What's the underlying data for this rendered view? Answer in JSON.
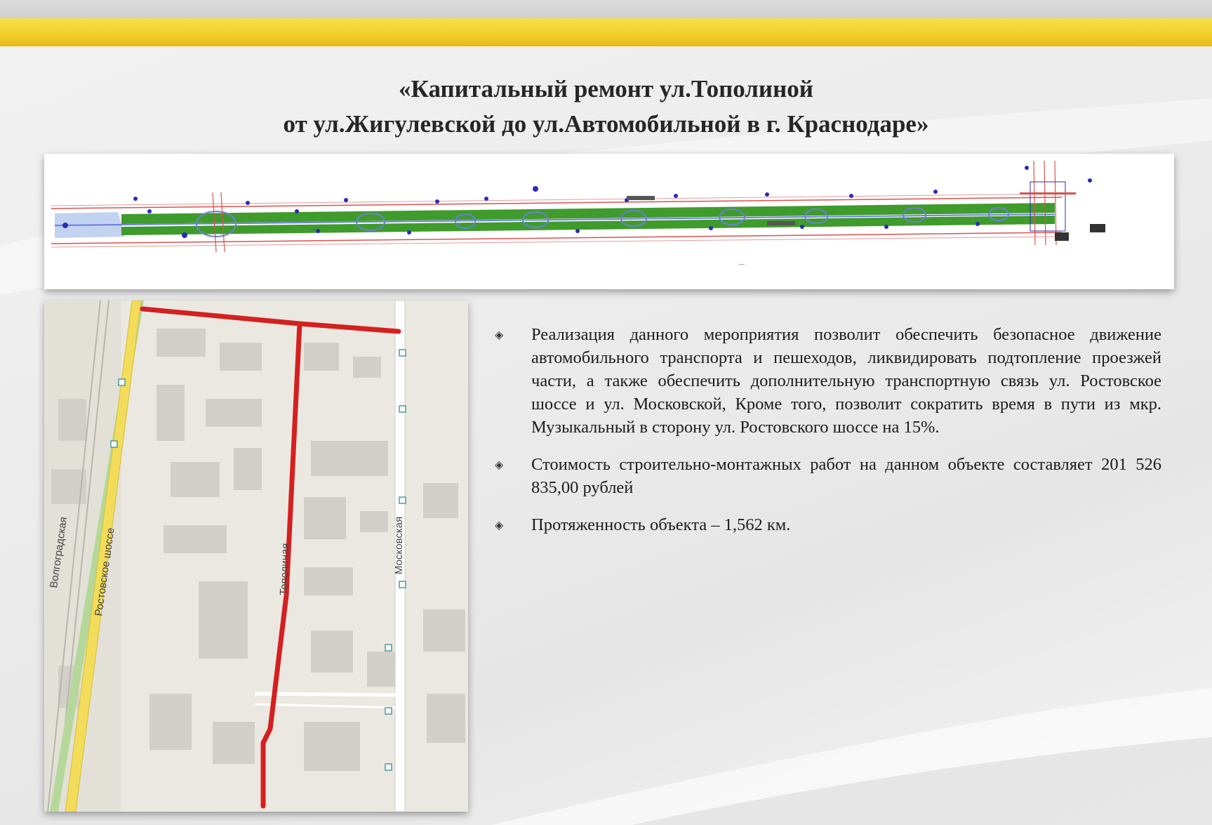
{
  "title": {
    "line1": "«Капитальный ремонт ул.Тополиной",
    "line2": "от ул.Жигулевской до ул.Автомобильной в г. Краснодаре»"
  },
  "map": {
    "labels": {
      "volgogradskaya": "Волгоградская",
      "rostovskoe": "Ростовское шоссе",
      "topolinaya": "Тополиная",
      "moskovskaya": "Московская"
    },
    "colors": {
      "route": "#d42020",
      "highway": "#f2dc5a",
      "block": "#cfccc5",
      "road": "#ffffff"
    }
  },
  "plan": {
    "colors": {
      "green": "#3f9b2c",
      "red": "#d9534f",
      "blue": "#2a2ab8"
    }
  },
  "bullets": [
    {
      "marker": "◈",
      "text": "Реализация данного мероприятия позволит обеспечить безопасное движение автомобильного транспорта и пешеходов, ликвидировать подтопление проезжей части, а также обеспечить дополнительную транспортную связь ул. Ростовское шоссе и ул. Московской, Кроме того, позволит сократить время в пути из мкр. Музыкальный в сторону ул. Ростовского шоссе на 15%."
    },
    {
      "marker": "◈",
      "text": "Стоимость строительно-монтажных работ на данном объекте составляет 201 526 835,00 рублей"
    },
    {
      "marker": "◈",
      "text": "Протяженность объекта – 1,562 км."
    }
  ]
}
